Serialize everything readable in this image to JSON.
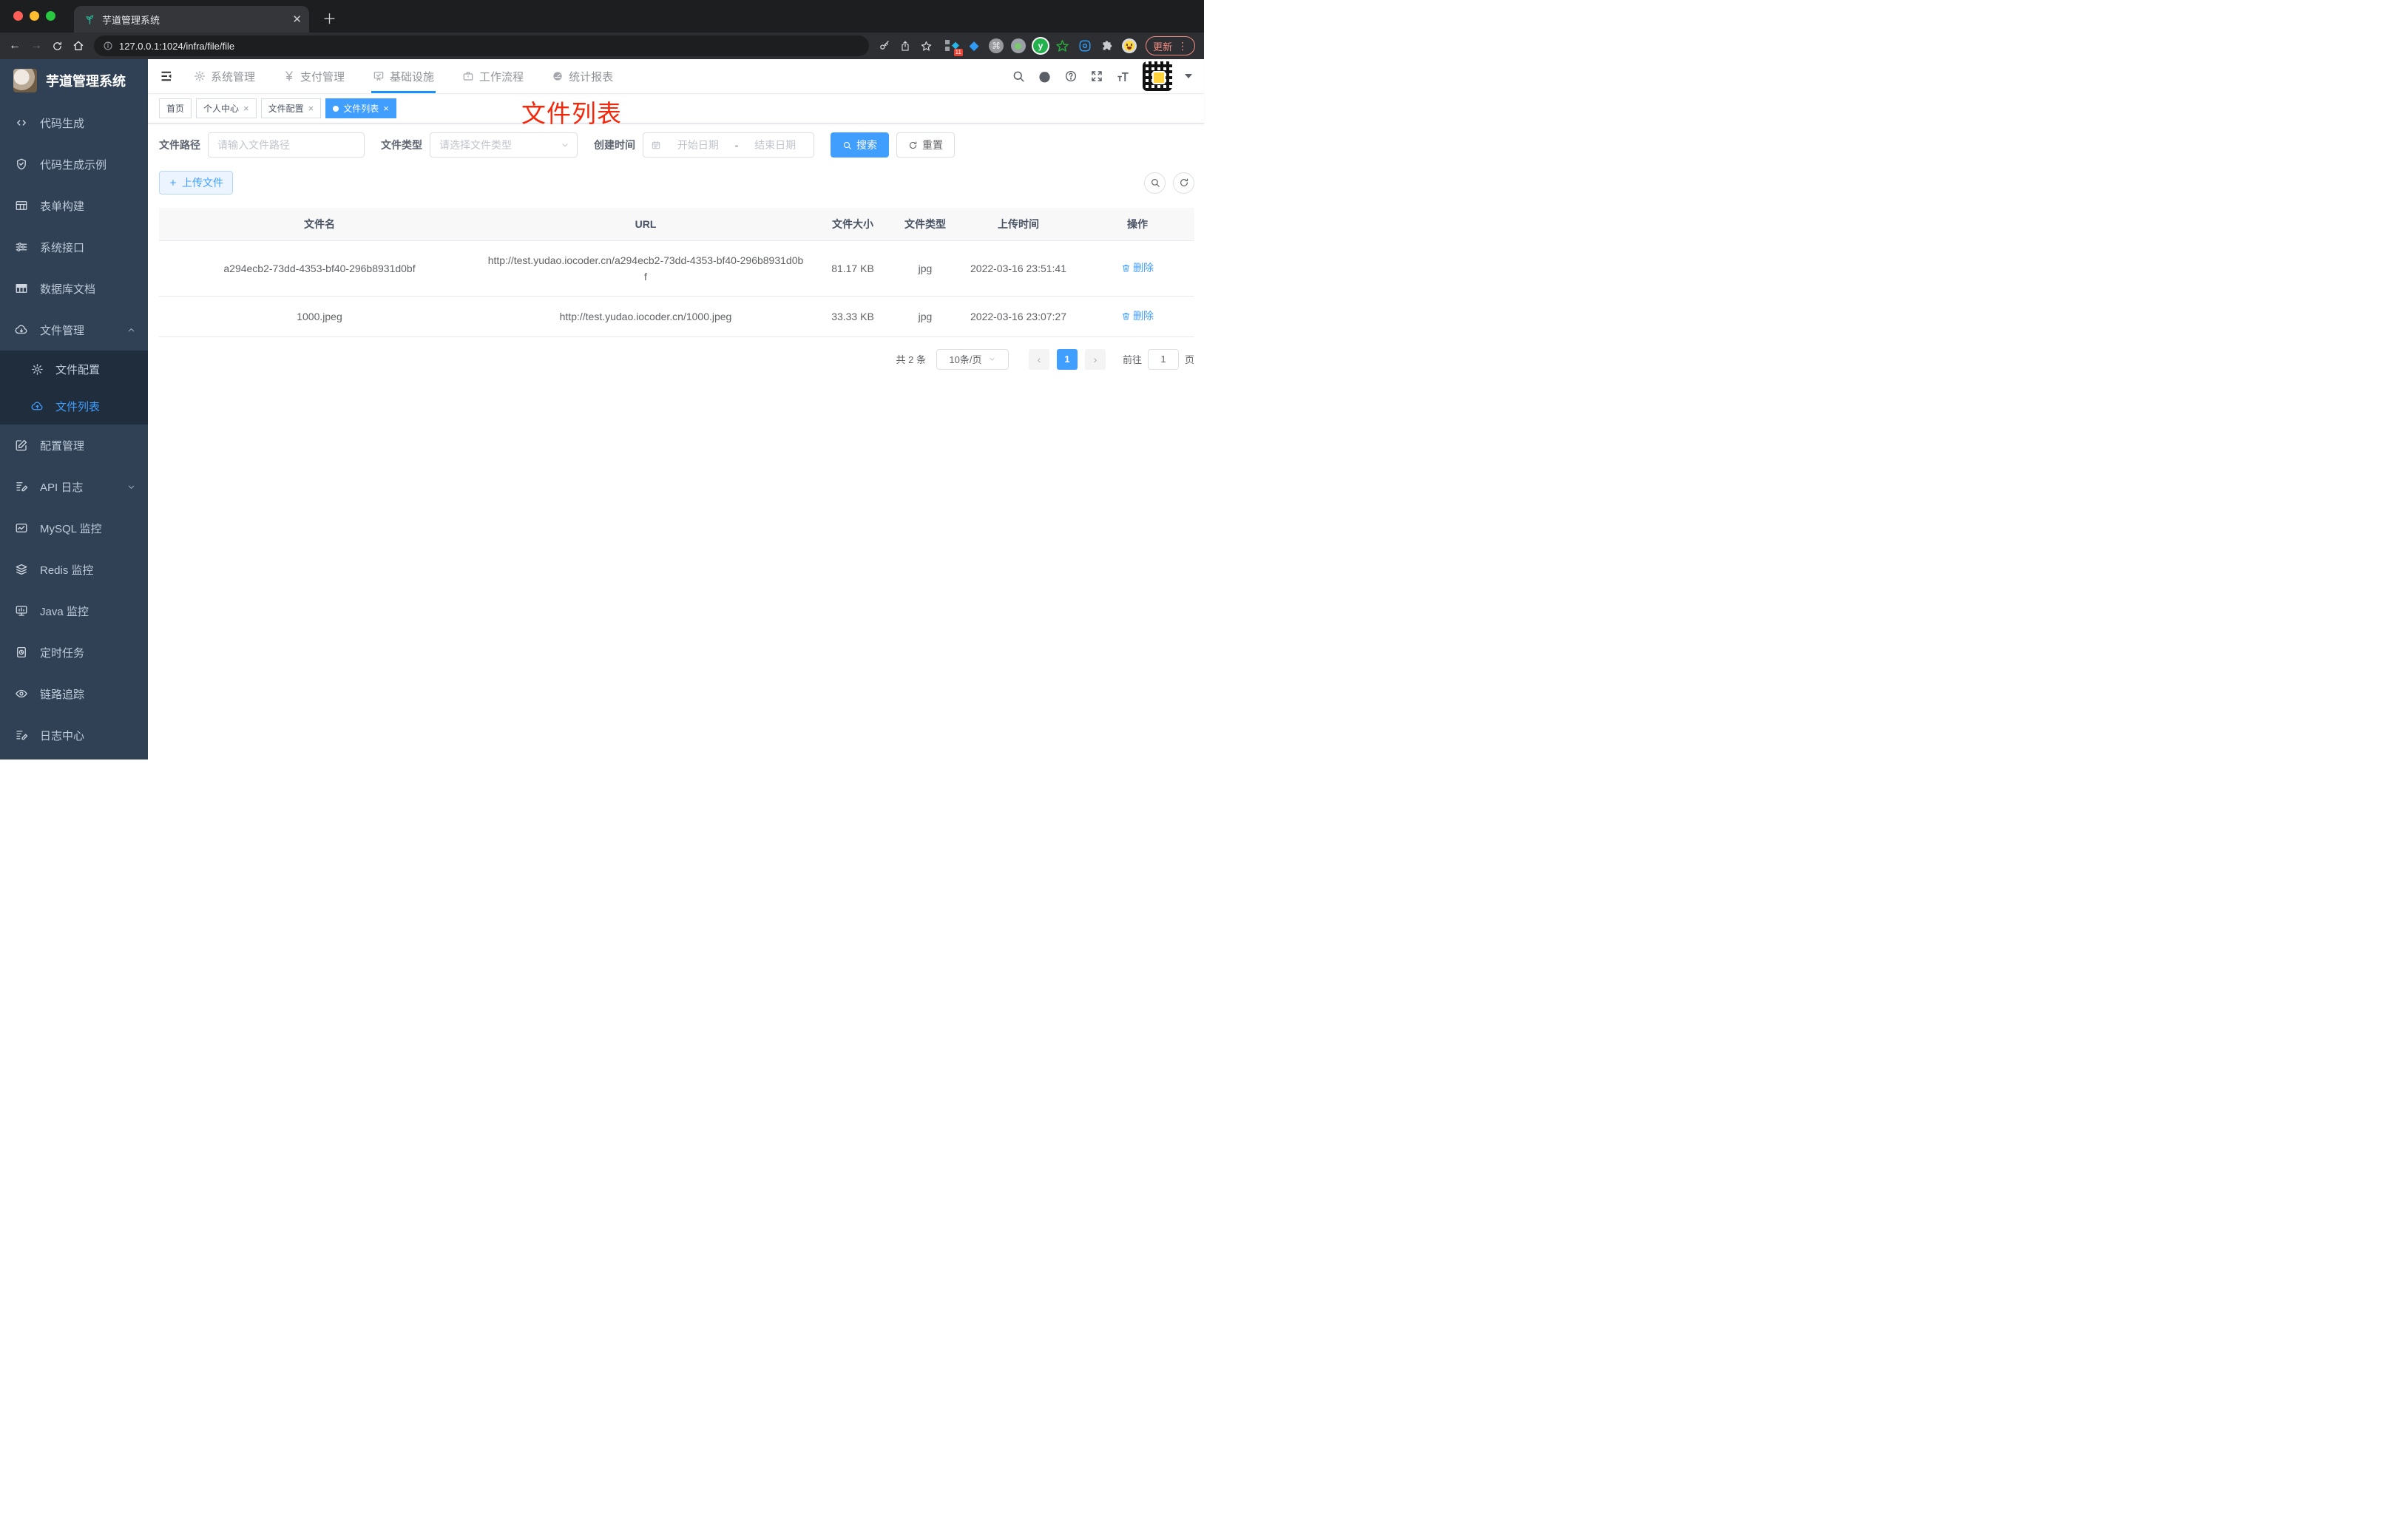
{
  "colors": {
    "accent": "#409EFF",
    "nav_underline": "#1890ff",
    "sidebar_bg": "#304156",
    "submenu_bg": "#1f2d3d",
    "annotation_red": "#f5270b"
  },
  "browser": {
    "tab_title": "芋道管理系统",
    "url": "127.0.0.1:1024/infra/file/file",
    "update_label": "更新",
    "extension_badge": "11"
  },
  "sidebar": {
    "title": "芋道管理系统",
    "items": [
      {
        "label": "代码生成"
      },
      {
        "label": "代码生成示例"
      },
      {
        "label": "表单构建"
      },
      {
        "label": "系统接口"
      },
      {
        "label": "数据库文档"
      },
      {
        "label": "文件管理"
      },
      {
        "label": "配置管理"
      },
      {
        "label": "API 日志"
      },
      {
        "label": "MySQL 监控"
      },
      {
        "label": "Redis 监控"
      },
      {
        "label": "Java 监控"
      },
      {
        "label": "定时任务"
      },
      {
        "label": "链路追踪"
      },
      {
        "label": "日志中心"
      }
    ],
    "submenu": [
      {
        "label": "文件配置"
      },
      {
        "label": "文件列表"
      }
    ]
  },
  "topnav": {
    "menus": [
      {
        "label": "系统管理"
      },
      {
        "label": "支付管理"
      },
      {
        "label": "基础设施"
      },
      {
        "label": "工作流程"
      },
      {
        "label": "统计报表"
      }
    ]
  },
  "tags": [
    {
      "label": "首页"
    },
    {
      "label": "个人中心"
    },
    {
      "label": "文件配置"
    },
    {
      "label": "文件列表"
    }
  ],
  "annotation": "文件列表",
  "filters": {
    "path_label": "文件路径",
    "path_placeholder": "请输入文件路径",
    "type_label": "文件类型",
    "type_placeholder": "请选择文件类型",
    "time_label": "创建时间",
    "start_placeholder": "开始日期",
    "separator": "-",
    "end_placeholder": "结束日期",
    "search_label": "搜索",
    "reset_label": "重置"
  },
  "toolbar": {
    "upload_label": "上传文件"
  },
  "table": {
    "columns": [
      "文件名",
      "URL",
      "文件大小",
      "文件类型",
      "上传时间",
      "操作"
    ],
    "rows": [
      {
        "name": "a294ecb2-73dd-4353-bf40-296b8931d0bf",
        "url": "http://test.yudao.iocoder.cn/a294ecb2-73dd-4353-bf40-296b8931d0bf",
        "size": "81.17 KB",
        "type": "jpg",
        "time": "2022-03-16 23:51:41",
        "action": "删除"
      },
      {
        "name": "1000.jpeg",
        "url": "http://test.yudao.iocoder.cn/1000.jpeg",
        "size": "33.33 KB",
        "type": "jpg",
        "time": "2022-03-16 23:07:27",
        "action": "删除"
      }
    ]
  },
  "pagination": {
    "total": "共 2 条",
    "page_size": "10条/页",
    "prev": "‹",
    "page": "1",
    "next": "›",
    "goto_label": "前往",
    "goto_value": "1",
    "page_unit": "页"
  }
}
